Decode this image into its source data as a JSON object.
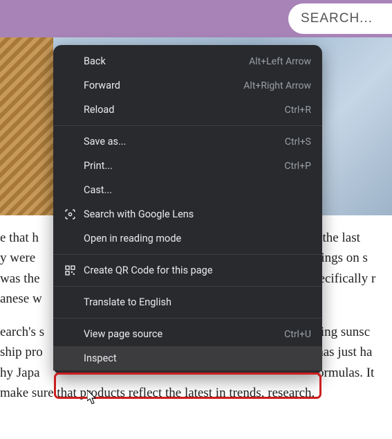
{
  "header": {
    "search_placeholder": "SEARCH..."
  },
  "article": {
    "p1_left": "e that h",
    "p1_right": "r the last ",
    "p2_left": "y were ",
    "p2_right": "atings on s",
    "p3_left": " was the",
    "p3_right": "pecifically r",
    "p4_left": "anese w",
    "p5_left": "earch's s",
    "p5_right": "ling sunsc",
    "p6_left": "ship pro",
    "p6_right": "has just ha",
    "p7_left": "hy Japa",
    "p7_right": "ormulas. It",
    "p8": "make sure that products reflect the latest in trends, research,"
  },
  "menu": {
    "back": {
      "label": "Back",
      "shortcut": "Alt+Left Arrow"
    },
    "forward": {
      "label": "Forward",
      "shortcut": "Alt+Right Arrow"
    },
    "reload": {
      "label": "Reload",
      "shortcut": "Ctrl+R"
    },
    "save_as": {
      "label": "Save as...",
      "shortcut": "Ctrl+S"
    },
    "print": {
      "label": "Print...",
      "shortcut": "Ctrl+P"
    },
    "cast": {
      "label": "Cast..."
    },
    "lens": {
      "label": "Search with Google Lens"
    },
    "reading": {
      "label": "Open in reading mode"
    },
    "qr": {
      "label": "Create QR Code for this page"
    },
    "translate": {
      "label": "Translate to English"
    },
    "view_source": {
      "label": "View page source",
      "shortcut": "Ctrl+U"
    },
    "inspect": {
      "label": "Inspect"
    }
  }
}
